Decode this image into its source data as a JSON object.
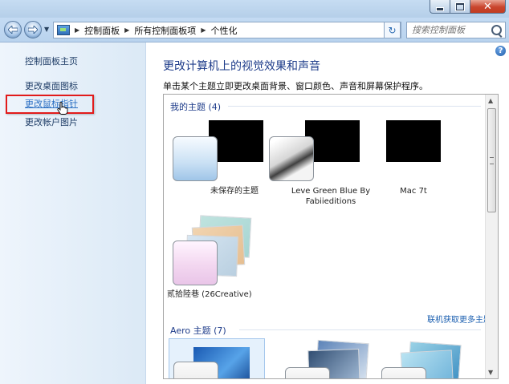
{
  "window": {
    "buttons": {
      "close_glyph": "✕"
    }
  },
  "address_bar": {
    "recent_glyph": "▼",
    "breadcrumbs": [
      "控制面板",
      "所有控制面板项",
      "个性化"
    ],
    "search_placeholder": "搜索控制面板"
  },
  "sidebar": {
    "items": [
      {
        "label": "控制面板主页"
      },
      {
        "label": "更改桌面图标"
      },
      {
        "label": "更改鼠标指针",
        "highlighted": true
      },
      {
        "label": "更改帐户图片"
      }
    ],
    "highlight_color": "#e21b1b"
  },
  "main": {
    "title": "更改计算机上的视觉效果和声音",
    "description": "单击某个主题立即更改桌面背景、窗口颜色、声音和屏幕保护程序。",
    "my_themes": {
      "header": "我的主题 (4)",
      "items": [
        {
          "name": "未保存的主题"
        },
        {
          "name": "Leve Green Blue By Fabiieditions"
        },
        {
          "name": "Mac 7t"
        },
        {
          "name": "贰拾陸巷 (26Creative)"
        }
      ],
      "more_link": "联机获取更多主题"
    },
    "aero_themes": {
      "header": "Aero 主题 (7)"
    }
  },
  "colors": {
    "title_blue": "#1e3c8a",
    "link_blue": "#1b5fb0",
    "sidebar_text": "#1e3c66"
  }
}
